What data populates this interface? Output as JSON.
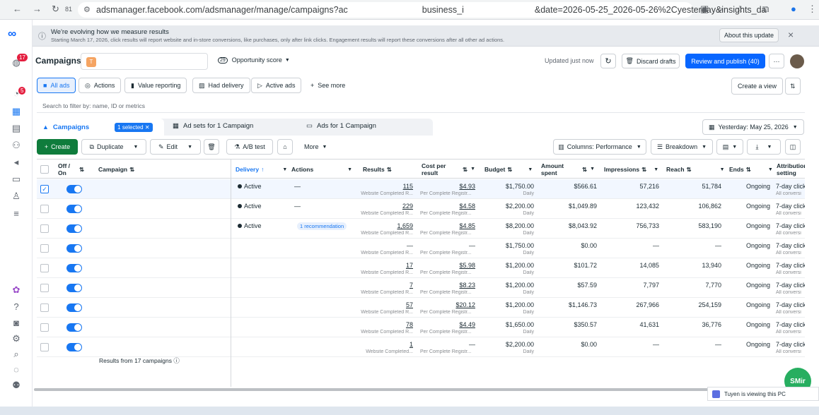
{
  "browser": {
    "tab_count": "81",
    "url_part1": "adsmanager.facebook.com/adsmanager/manage/campaigns?ac",
    "url_part2": "business_i",
    "url_part3": "&date=2026-05-25_2026-05-26%2Cyesterday&insights_da"
  },
  "notice": {
    "title": "We're evolving how we measure results",
    "body": "Starting March 17, 2026, click results will report website and in-store conversions, like purchases, only after link clicks. Engagement results will report these conversions after all other ad actions.",
    "about_label": "About this update",
    "close": "×"
  },
  "rail_badges": {
    "notifications": "17",
    "campaigns": "5"
  },
  "header": {
    "title": "Campaigns",
    "account_initial": "T",
    "opp_score": "29",
    "opp_label": "Opportunity score",
    "updated": "Updated just now",
    "discard": "Discard drafts",
    "publish": "Review and publish (40)",
    "more": "···"
  },
  "filters": {
    "items": [
      "All ads",
      "Actions",
      "Value reporting",
      "Had delivery",
      "Active ads"
    ],
    "see_more": "See more",
    "create_view": "Create a view"
  },
  "search": {
    "placeholder": "Search to filter by: name, ID or metrics"
  },
  "level_tabs": {
    "campaigns": "Campaigns",
    "selected": "1 selected",
    "adsets": "Ad sets for 1 Campaign",
    "ads": "Ads for 1 Campaign",
    "date": "Yesterday: May 25, 2026"
  },
  "toolbar": {
    "create": "Create",
    "duplicate": "Duplicate",
    "edit": "Edit",
    "abtest": "A/B test",
    "more": "More",
    "columns": "Columns: Performance",
    "breakdown": "Breakdown"
  },
  "columns": {
    "offon": "Off / On",
    "campaign": "Campaign",
    "delivery": "Delivery",
    "actions": "Actions",
    "results": "Results",
    "cpr": "Cost per result",
    "budget": "Budget",
    "amount": "Amount spent",
    "impressions": "Impressions",
    "reach": "Reach",
    "ends": "Ends",
    "attribution": "Attribution setting"
  },
  "rows": [
    {
      "delivery": "Active",
      "actions": "—",
      "results": "115",
      "results_sub": "Website Completed R...",
      "cpr": "$4.93",
      "cpr_sub": "Per Complete Registr...",
      "budget": "$1,750.00",
      "budget_sub": "Daily",
      "amount": "$566.61",
      "impressions": "57,216",
      "reach": "51,784",
      "ends": "Ongoing",
      "attr": "7-day click",
      "attr_sub": "All conversi"
    },
    {
      "delivery": "Active",
      "actions": "—",
      "results": "229",
      "results_sub": "Website Completed R...",
      "cpr": "$4.58",
      "cpr_sub": "Per Complete Registr...",
      "budget": "$2,200.00",
      "budget_sub": "Daily",
      "amount": "$1,049.89",
      "impressions": "123,432",
      "reach": "106,862",
      "ends": "Ongoing",
      "attr": "7-day click",
      "attr_sub": "All conversi"
    },
    {
      "delivery": "Active",
      "actions": "1 recommendation",
      "results": "1,659",
      "results_sub": "Website Completed R...",
      "cpr": "$4.85",
      "cpr_sub": "Per Complete Registr...",
      "budget": "$8,200.00",
      "budget_sub": "Daily",
      "amount": "$8,043.92",
      "impressions": "756,733",
      "reach": "583,190",
      "ends": "Ongoing",
      "attr": "7-day click",
      "attr_sub": "All conversi"
    },
    {
      "delivery": "",
      "actions": "",
      "results": "—",
      "results_sub": "Website Completed R...",
      "cpr": "—",
      "cpr_sub": "Per Complete Registr...",
      "budget": "$1,750.00",
      "budget_sub": "Daily",
      "amount": "$0.00",
      "impressions": "—",
      "reach": "—",
      "ends": "Ongoing",
      "attr": "7-day click",
      "attr_sub": "All conversi"
    },
    {
      "delivery": "",
      "actions": "",
      "results": "17",
      "results_sub": "Website Completed R...",
      "cpr": "$5.98",
      "cpr_sub": "Per Complete Registr...",
      "budget": "$1,200.00",
      "budget_sub": "Daily",
      "amount": "$101.72",
      "impressions": "14,085",
      "reach": "13,940",
      "ends": "Ongoing",
      "attr": "7-day click",
      "attr_sub": "All conversi"
    },
    {
      "delivery": "",
      "actions": "",
      "results": "7",
      "results_sub": "Website Completed R...",
      "cpr": "$8.23",
      "cpr_sub": "Per Complete Registr...",
      "budget": "$1,200.00",
      "budget_sub": "Daily",
      "amount": "$57.59",
      "impressions": "7,797",
      "reach": "7,770",
      "ends": "Ongoing",
      "attr": "7-day click",
      "attr_sub": "All conversi"
    },
    {
      "delivery": "",
      "actions": "",
      "results": "57",
      "results_sub": "Website Completed R...",
      "cpr": "$20.12",
      "cpr_sub": "Per Complete Registr...",
      "budget": "$1,200.00",
      "budget_sub": "Daily",
      "amount": "$1,146.73",
      "impressions": "267,966",
      "reach": "254,159",
      "ends": "Ongoing",
      "attr": "7-day click",
      "attr_sub": "All conversi"
    },
    {
      "delivery": "",
      "actions": "",
      "results": "78",
      "results_sub": "Website Completed R...",
      "cpr": "$4.49",
      "cpr_sub": "Per Complete Registr...",
      "budget": "$1,650.00",
      "budget_sub": "Daily",
      "amount": "$350.57",
      "impressions": "41,631",
      "reach": "36,776",
      "ends": "Ongoing",
      "attr": "7-day click",
      "attr_sub": "All conversi"
    },
    {
      "delivery": "",
      "actions": "",
      "results": "1",
      "results_sub": "Website Completed...",
      "cpr": "—",
      "cpr_sub": "Per Complete Registr...",
      "budget": "$2,200.00",
      "budget_sub": "Daily",
      "amount": "$0.00",
      "impressions": "—",
      "reach": "—",
      "ends": "Ongoing",
      "attr": "7-day click",
      "attr_sub": "All conversi"
    }
  ],
  "footer": {
    "results_from": "Results from 17 campaigns"
  },
  "viewing": {
    "text": "Tuyen is viewing this PC"
  },
  "chat_bubble": "SMir",
  "accent": "#1877f2",
  "brand_green": "#0f7c3c"
}
